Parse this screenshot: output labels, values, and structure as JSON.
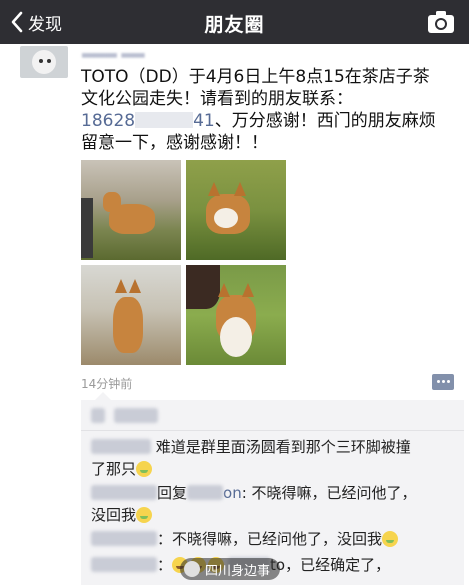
{
  "header": {
    "back_label": "发现",
    "title": "朋友圈"
  },
  "post": {
    "line1": "TOTO（DD）于4月6日上午8点15在茶店子茶",
    "line2": "文化公园走失！请看到的朋友联系：",
    "phone_visible_start": "18628",
    "phone_visible_end": "41",
    "line3_rest": "、万分感谢！西门的朋友麻烦",
    "line4": "留意一下，感谢感谢！！",
    "timestamp": "14分钟前"
  },
  "comments": [
    {
      "reply_fragment": "",
      "text_line1": "难道是群里面汤圆看到那个三环脚被撞",
      "text_line2": "了那只"
    },
    {
      "reply_word": "回复",
      "reply_fragment": "on",
      "text_line1": ": 不晓得嘛，已经问他了，",
      "text_line2": "没回我"
    },
    {
      "text_line1": "：不晓得嘛，已经问他了，没回我"
    },
    {
      "text_line1_prefix": "：",
      "text_line1_mid": "to，已经确定了，"
    }
  ],
  "watermark": {
    "text": "四川身边事"
  },
  "colors": {
    "topbar": "#2e2e33",
    "link": "#576b95",
    "comments_bg": "#f3f3f5"
  },
  "icons": [
    "back-chevron-icon",
    "camera-icon",
    "comment-more-icon"
  ]
}
